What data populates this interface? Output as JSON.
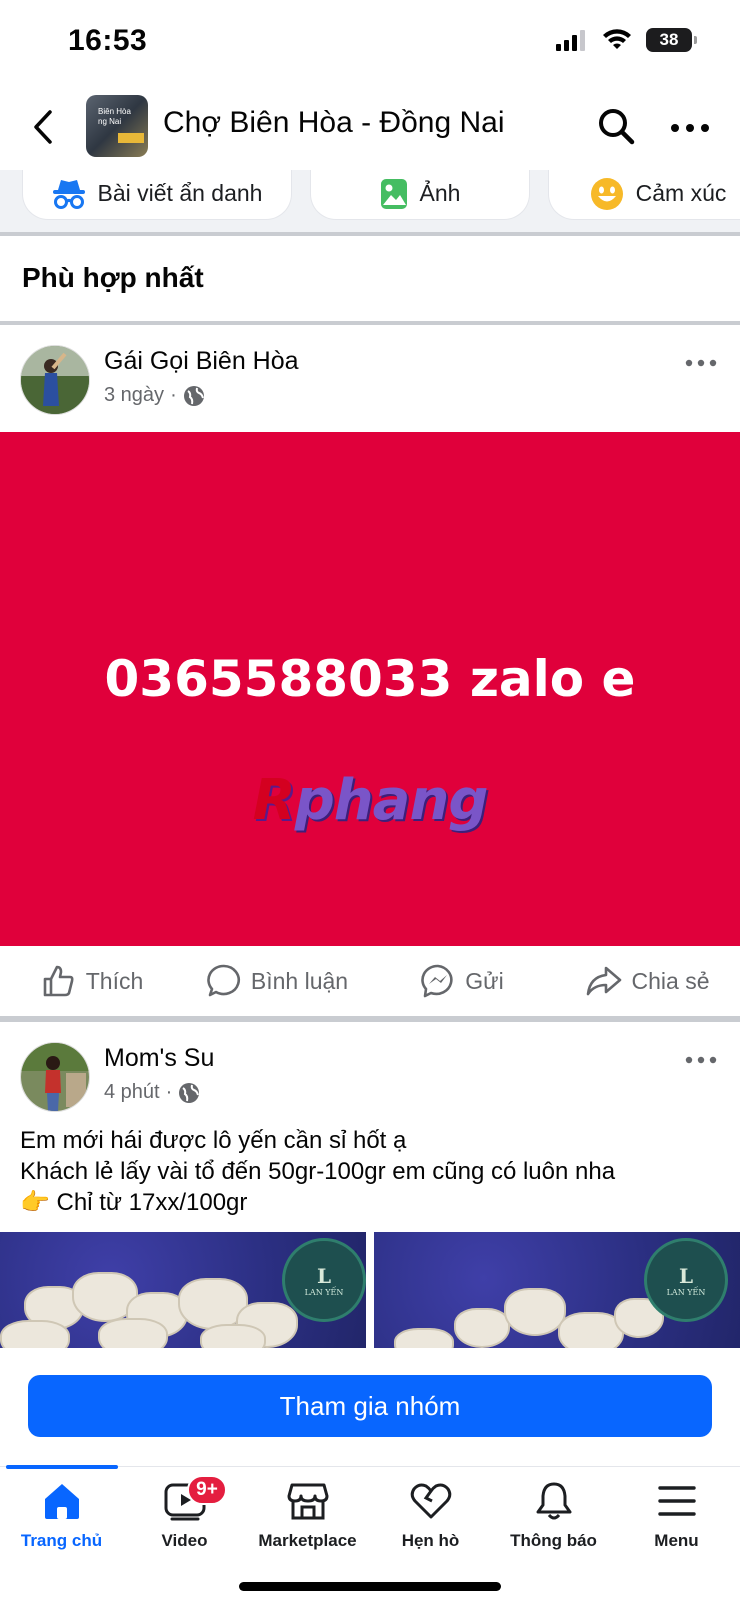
{
  "status_bar": {
    "time": "16:53",
    "battery": "38"
  },
  "header": {
    "group_name": "Chợ Biên Hòa - Đồng Nai",
    "thumb_text": "Biên Hòa\nng Nai"
  },
  "composer_chips": [
    {
      "label": "Bài viết ẩn danh",
      "icon": "incognito-icon"
    },
    {
      "label": "Ảnh",
      "icon": "photo-icon"
    },
    {
      "label": "Cảm xúc",
      "icon": "smiley-icon"
    }
  ],
  "section_title": "Phù hợp nhất",
  "posts": [
    {
      "author": "Gái Gọi Biên Hòa",
      "time": "3 ngày",
      "image_text": "0365588033 zalo e",
      "watermark_1": "R",
      "watermark_2": "phang"
    },
    {
      "author": "Mom's Su",
      "time": "4 phút",
      "text_lines": [
        "Em mới hái được lô yến cần sỉ hốt ạ",
        "Khách lẻ lấy vài tổ đến 50gr-100gr em cũng có luôn nha",
        "👉 Chỉ từ 17xx/100gr"
      ],
      "seal_text": "LAN YẾN"
    }
  ],
  "actions": {
    "like": "Thích",
    "comment": "Bình luận",
    "send": "Gửi",
    "share": "Chia sẻ"
  },
  "join_button": "Tham gia nhóm",
  "tabs": [
    {
      "label": "Trang chủ",
      "icon": "home-icon",
      "active": true
    },
    {
      "label": "Video",
      "icon": "video-icon",
      "badge": "9+"
    },
    {
      "label": "Marketplace",
      "icon": "marketplace-icon"
    },
    {
      "label": "Hẹn hò",
      "icon": "heart-icon"
    },
    {
      "label": "Thông báo",
      "icon": "bell-icon"
    },
    {
      "label": "Menu",
      "icon": "menu-icon"
    }
  ],
  "colors": {
    "accent": "#0866ff",
    "post_image_bg": "#e0003b",
    "badge": "#e41e3f"
  }
}
